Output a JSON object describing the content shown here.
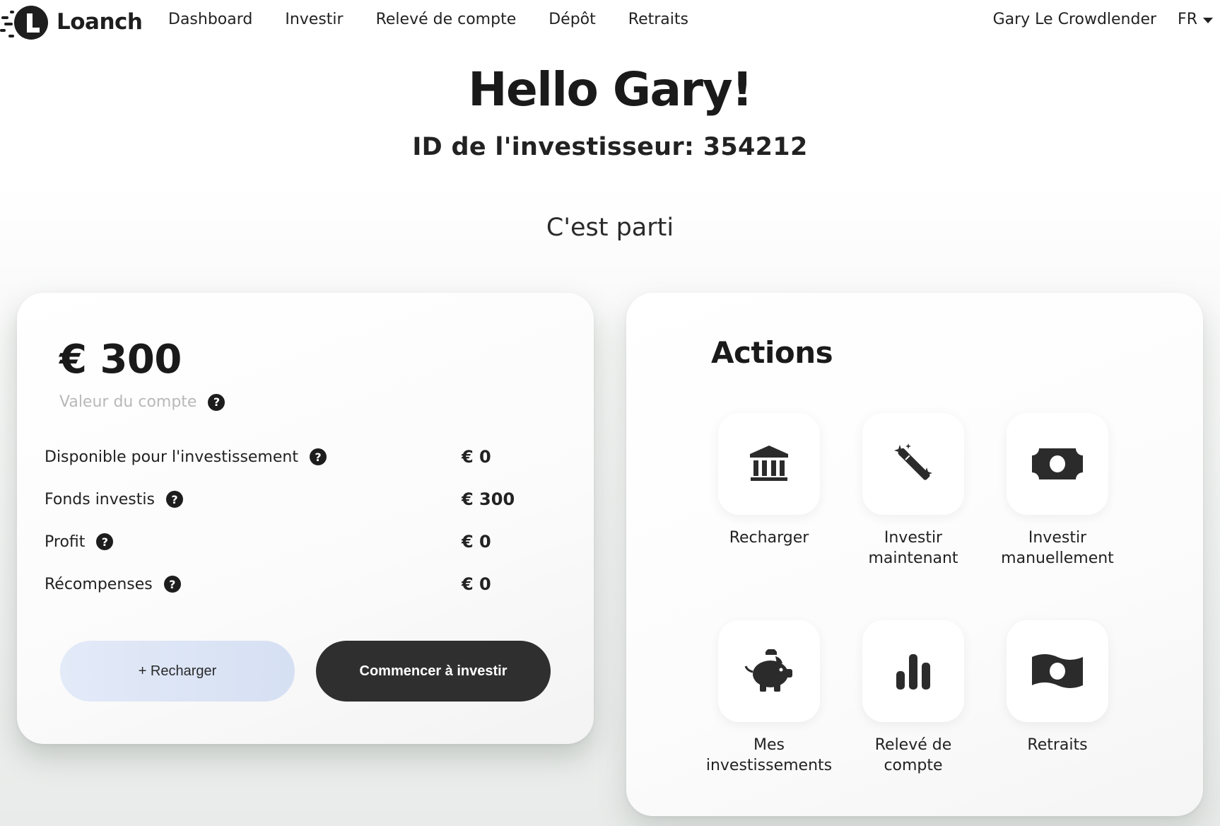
{
  "brand": {
    "name": "Loanch",
    "logo_icon": "loanch-logo-icon"
  },
  "nav": {
    "links": [
      {
        "label": "Dashboard"
      },
      {
        "label": "Investir"
      },
      {
        "label": "Relevé de compte"
      },
      {
        "label": "Dépôt"
      },
      {
        "label": "Retraits"
      }
    ],
    "user_name": "Gary Le Crowdlender",
    "language": "FR"
  },
  "header": {
    "greeting": "Hello Gary!",
    "investor_id": "ID de l'investisseur: 354212",
    "subtitle": "C'est parti"
  },
  "account": {
    "balance": "€ 300",
    "balance_label": "Valeur du compte",
    "stats": [
      {
        "label": "Disponible pour l'investissement",
        "value": "€ 0"
      },
      {
        "label": "Fonds investis",
        "value": "€ 300"
      },
      {
        "label": "Profit",
        "value": "€ 0"
      },
      {
        "label": "Récompenses",
        "value": "€ 0"
      }
    ],
    "recharge_button": "+ Recharger",
    "invest_button": "Commencer à investir"
  },
  "actions": {
    "title": "Actions",
    "items": [
      {
        "line1": "Recharger",
        "line2": "",
        "icon": "bank-icon"
      },
      {
        "line1": "Investir",
        "line2": "maintenant",
        "icon": "magic-wand-icon"
      },
      {
        "line1": "Investir",
        "line2": "manuellement",
        "icon": "money-bill-icon"
      },
      {
        "line1": "Mes",
        "line2": "investissements",
        "icon": "piggy-bank-icon"
      },
      {
        "line1": "Relevé de",
        "line2": "compte",
        "icon": "bar-chart-icon"
      },
      {
        "line1": "Retraits",
        "line2": "",
        "icon": "money-wave-icon"
      }
    ]
  },
  "help_glyph": "?",
  "colors": {
    "primary_dark": "#2f2f2f",
    "recharge_button_bg": "#dde5f5",
    "muted_text": "#b8b8b8"
  }
}
